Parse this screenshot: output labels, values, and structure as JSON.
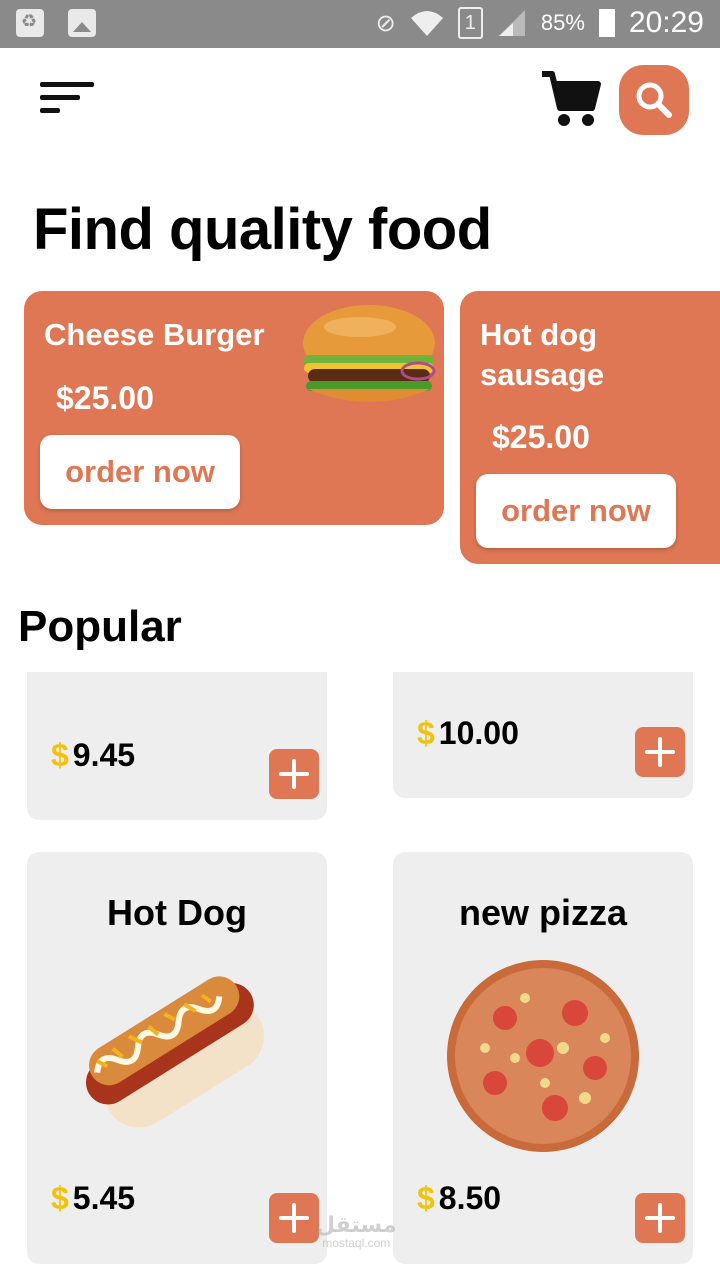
{
  "status_bar": {
    "battery": "85%",
    "time": "20:29",
    "sim_slot": "1"
  },
  "header": {
    "title": "Find quality food"
  },
  "promos": [
    {
      "name": "Cheese Burger",
      "price": "$25.00",
      "button": "order now"
    },
    {
      "name": "Hot dog sausage",
      "price": "$25.00",
      "button": "order now"
    }
  ],
  "popular": {
    "title": "Popular",
    "items": [
      {
        "name": "",
        "currency": "$",
        "price": "9.45"
      },
      {
        "name": "",
        "currency": "$",
        "price": "10.00"
      },
      {
        "name": "Hot Dog",
        "currency": "$",
        "price": "5.45"
      },
      {
        "name": "new pizza",
        "currency": "$",
        "price": "8.50"
      }
    ]
  },
  "watermark": {
    "text": "مستقل",
    "sub": "mostaql.com"
  },
  "colors": {
    "accent": "#df7755",
    "card_bg": "#eeeeee",
    "currency": "#f4c20d"
  }
}
